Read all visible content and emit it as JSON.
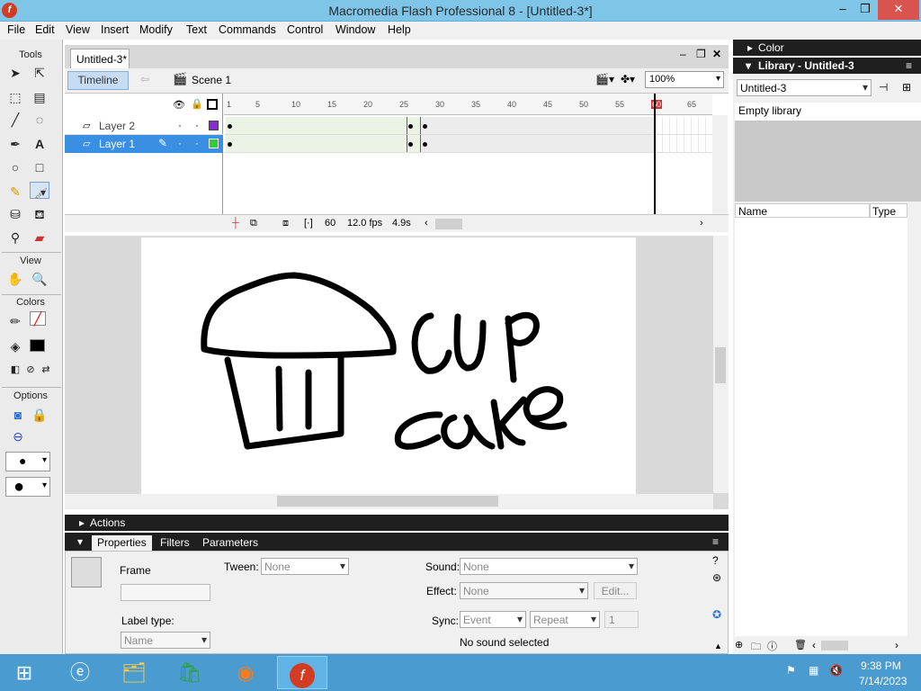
{
  "window": {
    "title": "Macromedia Flash Professional 8 - [Untitled-3*]",
    "app_icon": "flash-icon"
  },
  "menu": [
    "File",
    "Edit",
    "View",
    "Insert",
    "Modify",
    "Text",
    "Commands",
    "Control",
    "Window",
    "Help"
  ],
  "tools": {
    "title": "Tools",
    "view_label": "View",
    "colors_label": "Colors",
    "options_label": "Options"
  },
  "document": {
    "tab": "Untitled-3*"
  },
  "timeline": {
    "toggle": "Timeline",
    "scene": "Scene 1",
    "zoom": "100%",
    "ruler": [
      "1",
      "5",
      "10",
      "15",
      "20",
      "25",
      "30",
      "35",
      "40",
      "45",
      "50",
      "55",
      "60",
      "65"
    ],
    "layers": [
      {
        "name": "Layer 2",
        "active": false,
        "color": "#8a2bd2"
      },
      {
        "name": "Layer 1",
        "active": true,
        "color": "#33cc33"
      }
    ],
    "frame": "60",
    "fps": "12.0 fps",
    "time": "4.9s"
  },
  "stage": {
    "text_line1": "CUP",
    "text_line2": "CAKE"
  },
  "panels": {
    "actions": "Actions",
    "tabs": [
      "Properties",
      "Filters",
      "Parameters"
    ]
  },
  "properties": {
    "type": "Frame",
    "tween_label": "Tween:",
    "tween_value": "None",
    "sound_label": "Sound:",
    "sound_value": "None",
    "effect_label": "Effect:",
    "effect_value": "None",
    "edit_label": "Edit...",
    "label_type": "Label type:",
    "label_type_value": "Name",
    "sync_label": "Sync:",
    "sync_value": "Event",
    "repeat_value": "Repeat",
    "repeat_count": "1",
    "no_sound": "No sound selected"
  },
  "library": {
    "color_title": "Color",
    "title": "Library - Untitled-3",
    "doc": "Untitled-3",
    "empty": "Empty library",
    "col_name": "Name",
    "col_type": "Type"
  },
  "taskbar": {
    "time": "9:38 PM",
    "date": "7/14/2023"
  }
}
